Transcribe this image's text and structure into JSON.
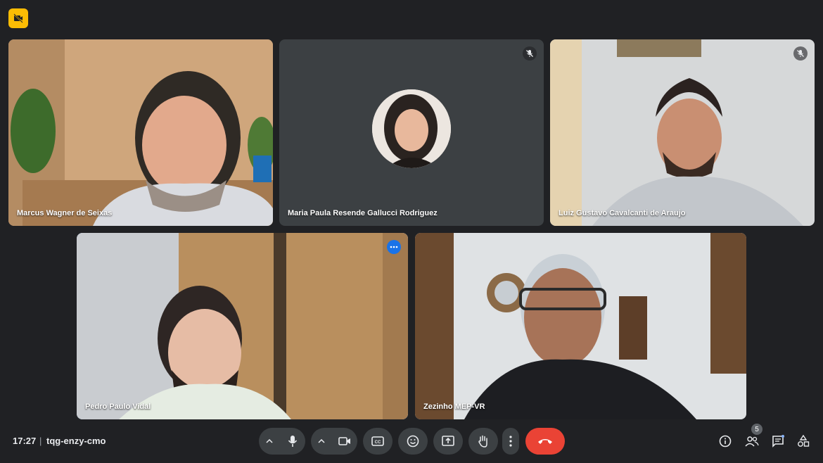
{
  "participants": [
    {
      "name": "Marcus Wagner de Seixas",
      "muted": false
    },
    {
      "name": "Maria Paula Resende Gallucci Rodriguez",
      "muted": true,
      "camera_off": true
    },
    {
      "name": "Luiz Gustavo Cavalcanti de Araujo",
      "muted": true
    },
    {
      "name": "Pedro Paulo Vidal",
      "muted": false,
      "pinned": true
    },
    {
      "name": "Zezinho MEP-VR",
      "muted": false
    }
  ],
  "meeting": {
    "time": "17:27",
    "separator": "|",
    "code": "tqg-enzy-cmo"
  },
  "people_count": "5",
  "colors": {
    "background": "#202124",
    "tile": "#3c4043",
    "end_call": "#ea4335",
    "active_border": "#8ab4f8",
    "badge": "#fbbc04"
  },
  "icons": {
    "top_left": "camera-off-badge-icon",
    "controls": [
      "chevron-up-icon",
      "mic-icon",
      "chevron-up-icon",
      "camera-icon",
      "captions-icon",
      "emoji-icon",
      "present-icon",
      "hand-icon",
      "more-vert-icon",
      "end-call-icon"
    ],
    "right": [
      "info-icon",
      "people-icon",
      "chat-icon",
      "activities-icon"
    ]
  }
}
